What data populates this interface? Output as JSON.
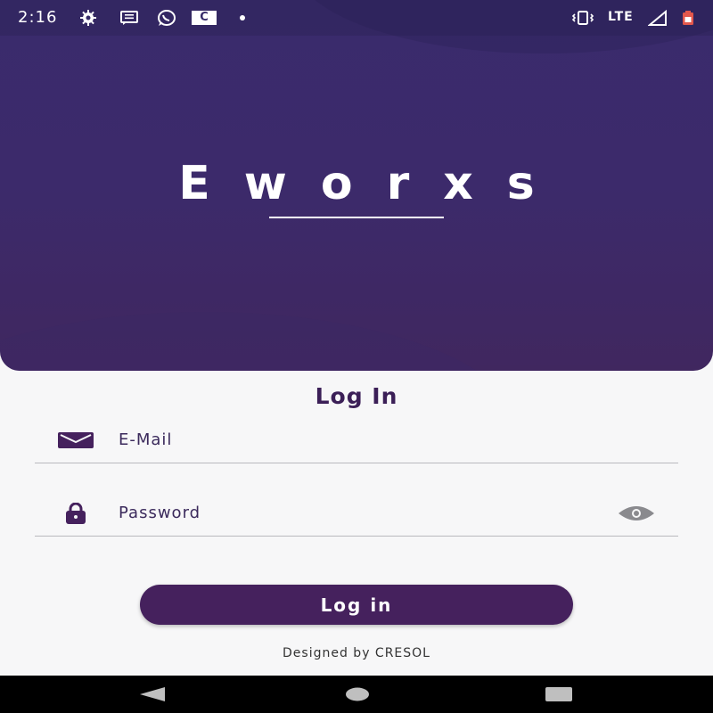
{
  "status_bar": {
    "time": "2:16",
    "icons": [
      "settings-icon",
      "message-icon",
      "whatsapp-icon",
      "c-app-icon",
      "dot-icon"
    ],
    "c_label": "C",
    "right_icons": [
      "vibrate-icon",
      "signal-icon",
      "battery-icon"
    ],
    "network": "LTE"
  },
  "hero": {
    "logo_text": "Eworxs",
    "colors": {
      "top": "#3a2b6c",
      "bottom": "#40275f"
    }
  },
  "form": {
    "title": "Log In",
    "email": {
      "placeholder": "E-Mail",
      "value": "",
      "icon": "mail-icon"
    },
    "password": {
      "placeholder": "Password",
      "value": "",
      "icon": "lock-icon",
      "toggle_icon": "eye-icon"
    },
    "submit_label": "Log in"
  },
  "footer": {
    "credit": "Designed by CRESOL"
  },
  "nav_bar": {
    "buttons": [
      "back-icon",
      "home-icon",
      "recents-icon"
    ]
  },
  "colors": {
    "accent": "#45215d",
    "title": "#3b1f57",
    "background": "#f7f7f8"
  }
}
